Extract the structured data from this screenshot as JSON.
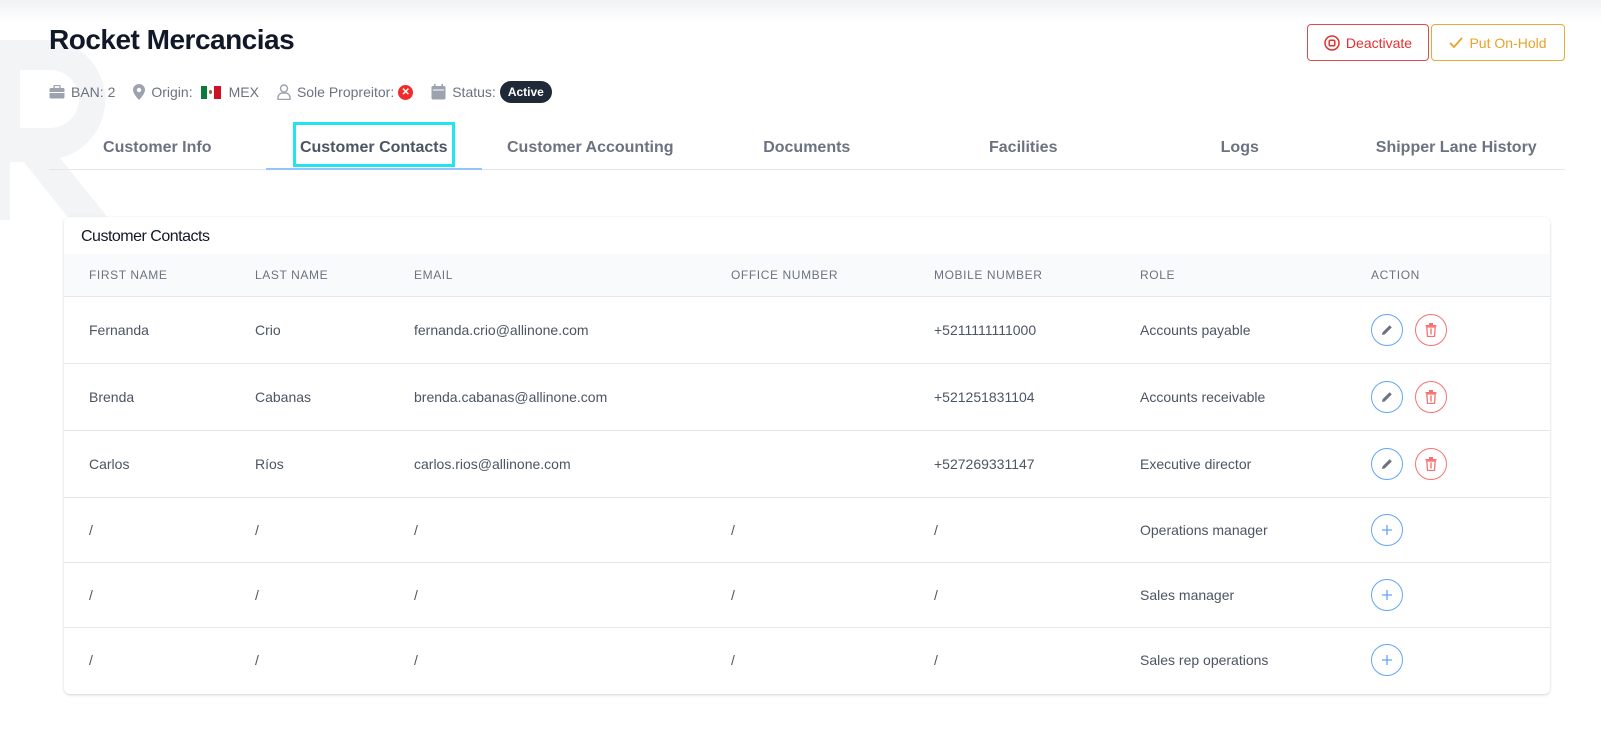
{
  "header": {
    "title": "Rocket Mercancias",
    "ban_label": "BAN: 2",
    "origin_label": "Origin:",
    "origin_value": "MEX",
    "sole_label": "Sole Propreitor:",
    "status_label": "Status:",
    "status_value": "Active",
    "deactivate_label": "Deactivate",
    "hold_label": "Put On-Hold"
  },
  "colors": {
    "accent_blue": "#60a5fa",
    "danger": "#e03131",
    "warning": "#e8a32a",
    "tab_highlight": "#22e4f0"
  },
  "tabs": [
    {
      "label": "Customer Info"
    },
    {
      "label": "Customer Contacts"
    },
    {
      "label": "Customer Accounting"
    },
    {
      "label": "Documents"
    },
    {
      "label": "Facilities"
    },
    {
      "label": "Logs"
    },
    {
      "label": "Shipper Lane History"
    }
  ],
  "active_tab": "Customer Contacts",
  "card": {
    "title": "Customer Contacts"
  },
  "table": {
    "columns": [
      "FIRST NAME",
      "LAST NAME",
      "EMAIL",
      "OFFICE NUMBER",
      "MOBILE NUMBER",
      "ROLE",
      "ACTION"
    ],
    "rows": [
      {
        "first": "Fernanda",
        "last": "Crio",
        "email": "fernanda.crio@allinone.com",
        "office": "",
        "mobile": "+5211111111000",
        "role": "Accounts payable"
      },
      {
        "first": "Brenda",
        "last": "Cabanas",
        "email": "brenda.cabanas@allinone.com",
        "office": "",
        "mobile": "+521251831104",
        "role": "Accounts receivable"
      },
      {
        "first": "Carlos",
        "last": "Ríos",
        "email": "carlos.rios@allinone.com",
        "office": "",
        "mobile": "+527269331147",
        "role": "Executive director"
      },
      {
        "first": "/",
        "last": "/",
        "email": "/",
        "office": "/",
        "mobile": "/",
        "role": "Operations manager"
      },
      {
        "first": "/",
        "last": "/",
        "email": "/",
        "office": "/",
        "mobile": "/",
        "role": "Sales manager"
      },
      {
        "first": "/",
        "last": "/",
        "email": "/",
        "office": "/",
        "mobile": "/",
        "role": "Sales rep operations"
      }
    ]
  }
}
